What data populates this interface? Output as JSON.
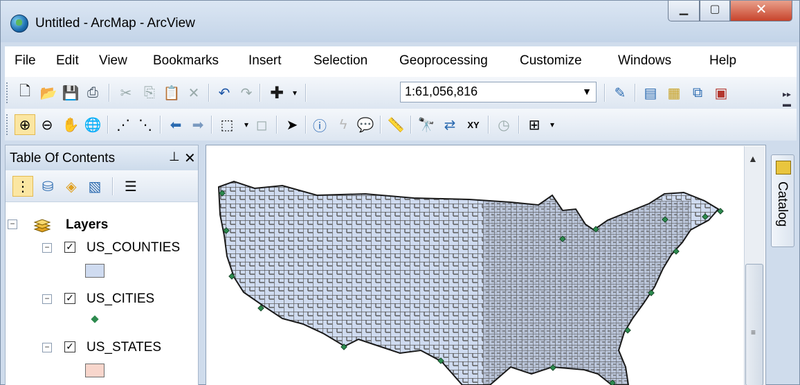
{
  "window": {
    "title": "Untitled - ArcMap - ArcView"
  },
  "menu": [
    "File",
    "Edit",
    "View",
    "Bookmarks",
    "Insert",
    "Selection",
    "Geoprocessing",
    "Customize",
    "Windows",
    "Help"
  ],
  "standard_toolbar": {
    "scale_value": "1:61,056,816"
  },
  "toc": {
    "title": "Table Of Contents",
    "root_label": "Layers",
    "layers": [
      {
        "name": "US_COUNTIES",
        "checked": true,
        "symbol": "polygon",
        "color": "#cfdbf0"
      },
      {
        "name": "US_CITIES",
        "checked": true,
        "symbol": "point",
        "color": "#2d8a4e"
      },
      {
        "name": "US_STATES",
        "checked": true,
        "symbol": "polygon",
        "color": "#f8d6cc"
      }
    ]
  },
  "side_tab": {
    "label": "Catalog"
  },
  "colors": {
    "county_fill": "#cfdbf0",
    "county_outline": "#5b5b5b",
    "city_point": "#2d8a4e",
    "state_fill": "#f8d6cc"
  },
  "icons": {
    "standard": [
      "new-document",
      "open-folder",
      "save",
      "print",
      "cut",
      "copy",
      "paste",
      "delete",
      "undo",
      "redo",
      "add-data",
      "scale-dropdown",
      "editor-toolbar",
      "table-of-contents",
      "catalog-window",
      "search-window",
      "arctoolbox"
    ],
    "tools": [
      "zoom-in",
      "zoom-out",
      "pan",
      "full-extent",
      "fixed-zoom-in",
      "fixed-zoom-out",
      "back-extent",
      "forward-extent",
      "select-features",
      "clear-selection",
      "select-elements",
      "identify",
      "hyperlink",
      "html-popup",
      "measure",
      "find",
      "find-route",
      "go-to-xy",
      "time-slider",
      "create-viewer-window"
    ]
  }
}
